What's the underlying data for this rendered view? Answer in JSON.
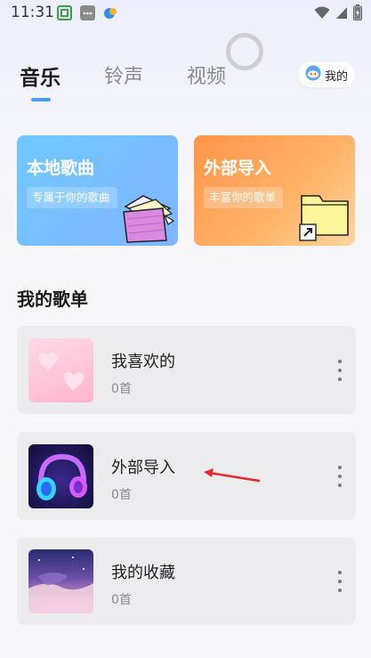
{
  "status_bar": {
    "time": "11:31",
    "icons": [
      "gallery-app-icon",
      "message-app-icon",
      "color-app-icon",
      "wifi-icon",
      "signal-icon",
      "battery-icon"
    ]
  },
  "tabs": [
    {
      "label": "音乐",
      "active": true
    },
    {
      "label": "铃声",
      "active": false
    },
    {
      "label": "视频",
      "active": false
    }
  ],
  "me_button": {
    "label": "我的"
  },
  "cards": {
    "local": {
      "title": "本地歌曲",
      "subtitle": "专属于你的歌曲",
      "icon": "folder-icon"
    },
    "import": {
      "title": "外部导入",
      "subtitle": "丰富你的歌单",
      "icon": "shortcut-folder-icon"
    }
  },
  "section": {
    "title": "我的歌单"
  },
  "playlists": [
    {
      "name": "我喜欢的",
      "count": "0首",
      "cover": "hearts-cover"
    },
    {
      "name": "外部导入",
      "count": "0首",
      "cover": "headphones-cover"
    },
    {
      "name": "我的收藏",
      "count": "0首",
      "cover": "sky-cover"
    }
  ],
  "colors": {
    "accent": "#4a9cf5",
    "card_local": "#6fc8ff",
    "card_import": "#ff9548",
    "annotation_arrow": "#e52b2b"
  }
}
